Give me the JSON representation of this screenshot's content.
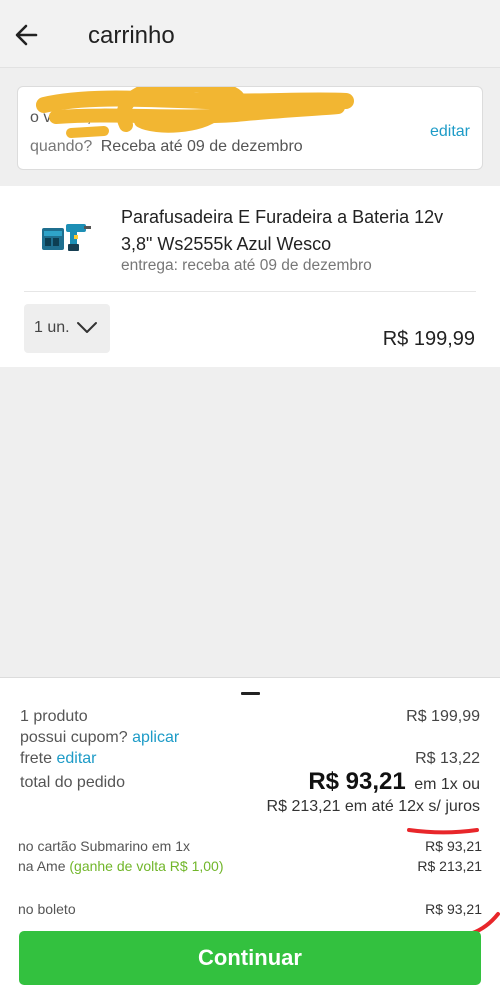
{
  "header": {
    "title": "carrinho",
    "back_icon": "arrow-left-icon"
  },
  "address": {
    "line": "o  ve   ne    ,  17",
    "when_label": "quando?",
    "when_text": "Receba até 09 de dezembro",
    "edit_label": "editar"
  },
  "product": {
    "name": "Parafusadeira E Furadeira a Bateria 12v 3,8\" Ws2555k Azul Wesco",
    "delivery": "entrega: receba até 09 de dezembro",
    "quantity": "1 un.",
    "price": "R$ 199,99"
  },
  "summary": {
    "products_label": "1 produto",
    "products_amount": "R$ 199,99",
    "coupon_label": "possui cupom?",
    "coupon_link": "aplicar",
    "shipping_label": "frete",
    "shipping_link": "editar",
    "shipping_amount": "R$ 13,22",
    "total_label": "total do pedido",
    "total_big": "R$ 93,21",
    "total_suffix": "em 1x ou",
    "installments": "R$ 213,21 em até 12x s/ juros",
    "card_label": "no cartão Submarino em 1x",
    "card_amount": "R$ 93,21",
    "ame_label": "na Ame",
    "ame_bonus": "(ganhe de volta R$ 1,00)",
    "ame_amount": "R$ 213,21",
    "boleto_label": "no boleto",
    "boleto_amount": "R$ 93,21",
    "continue_label": "Continuar"
  },
  "colors": {
    "accent": "#1d9bc7",
    "button": "#33c13f",
    "bonus": "#71b62a",
    "annotation": "#e8262a",
    "redaction": "#f2b632"
  }
}
